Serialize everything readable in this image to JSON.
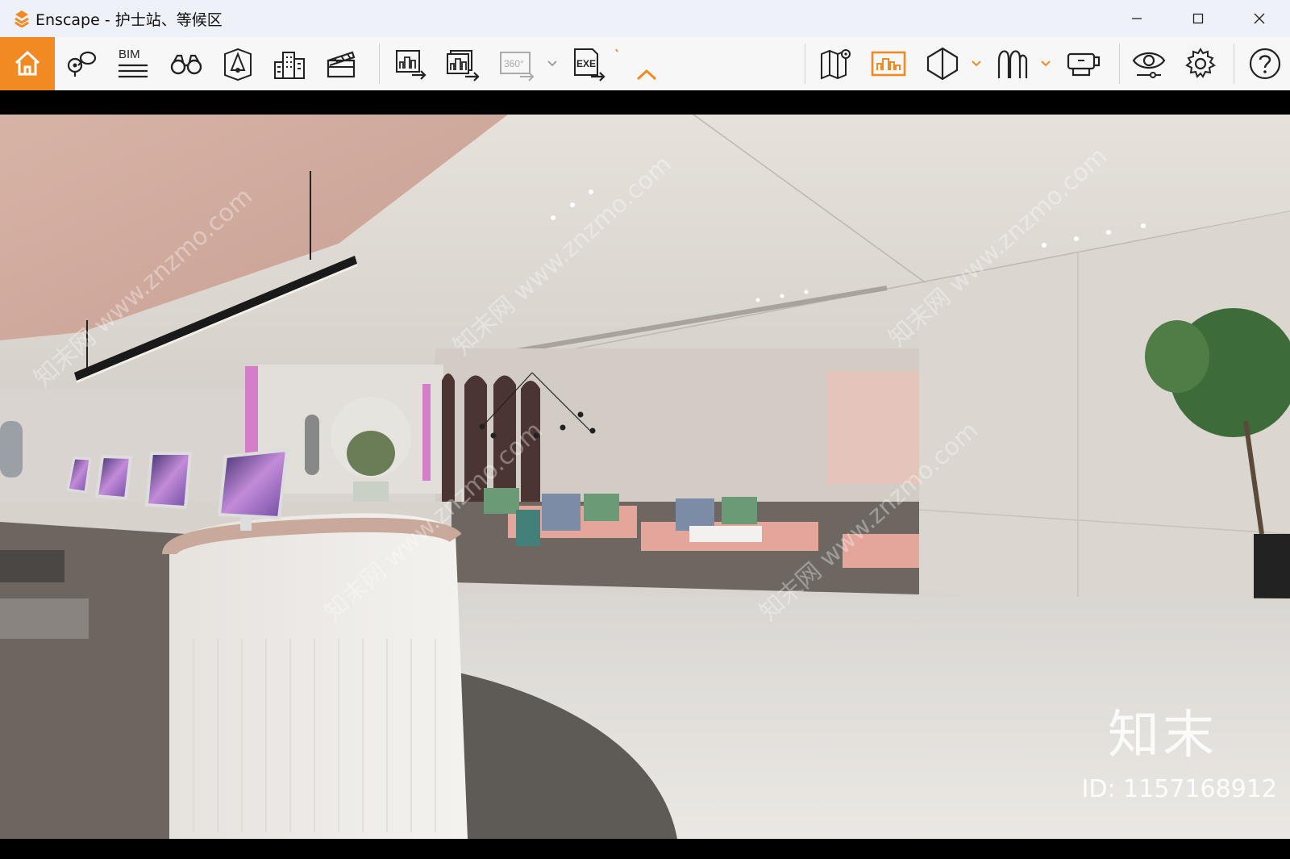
{
  "window": {
    "title": "Enscape - 护士站、等候区",
    "controls": [
      "minimize",
      "maximize",
      "close"
    ]
  },
  "toolbar": {
    "left_group": [
      {
        "name": "home",
        "icon": "home-icon",
        "active": true
      },
      {
        "name": "views",
        "icon": "map-pin-icon"
      },
      {
        "name": "bim",
        "icon": "bim-icon",
        "label": "BIM"
      },
      {
        "name": "binoculars",
        "icon": "binoculars-icon"
      },
      {
        "name": "asset-library",
        "icon": "asset-library-icon"
      },
      {
        "name": "buildings",
        "icon": "buildings-icon"
      },
      {
        "name": "video-editor",
        "icon": "clapperboard-icon"
      }
    ],
    "export_group": [
      {
        "name": "render-screenshot",
        "icon": "render-screenshot-icon"
      },
      {
        "name": "batch-render",
        "icon": "batch-render-icon"
      },
      {
        "name": "render-panorama",
        "icon": "panorama-icon",
        "label": "360°",
        "disabled": true
      },
      {
        "name": "export-exe",
        "icon": "exe-export-icon",
        "label": "EXE"
      }
    ],
    "right_group": [
      {
        "name": "map",
        "icon": "map-icon"
      },
      {
        "name": "collaborative-annotation",
        "icon": "annotation-icon",
        "active": true
      },
      {
        "name": "section",
        "icon": "section-cube-icon"
      },
      {
        "name": "people",
        "icon": "people-icon"
      },
      {
        "name": "vr-headset",
        "icon": "vr-headset-icon"
      },
      {
        "name": "visual-settings",
        "icon": "eye-icon"
      },
      {
        "name": "settings",
        "icon": "gear-icon"
      },
      {
        "name": "help",
        "icon": "help-icon"
      }
    ],
    "accent": "#f28a24"
  },
  "viewport": {
    "scene": "3D render of hospital nurse station and waiting area",
    "watermark_logo": "知末",
    "watermark_id": "ID: 1157168912",
    "watermark_repeat": "知末网 www.znzmo.com"
  }
}
